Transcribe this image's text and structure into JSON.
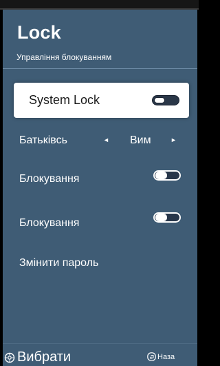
{
  "colors": {
    "panel_bg": "#3f5c75",
    "selected_bg": "#ffffff",
    "text": "#ffffff",
    "selected_text": "#1a1a1a",
    "toggle_track": "#27364a"
  },
  "header": {
    "title": "Lock",
    "subtitle": "Управління блокуванням"
  },
  "menu": {
    "system_lock": {
      "label": "System Lock",
      "toggle_state": "off",
      "selected": true
    },
    "parental": {
      "label": "Батьківсь",
      "value": "Вим",
      "left_arrow": "◄",
      "right_arrow": "►"
    },
    "block_1": {
      "label": "Блокування",
      "toggle_state": "off"
    },
    "block_2": {
      "label": "Блокування",
      "toggle_state": "off"
    },
    "change_password": {
      "label": "Змінити пароль"
    }
  },
  "footer": {
    "select_icon": "select-circle-icon",
    "select_label": "Вибрати",
    "back_icon": "back-return-icon",
    "back_label": "Наза"
  }
}
